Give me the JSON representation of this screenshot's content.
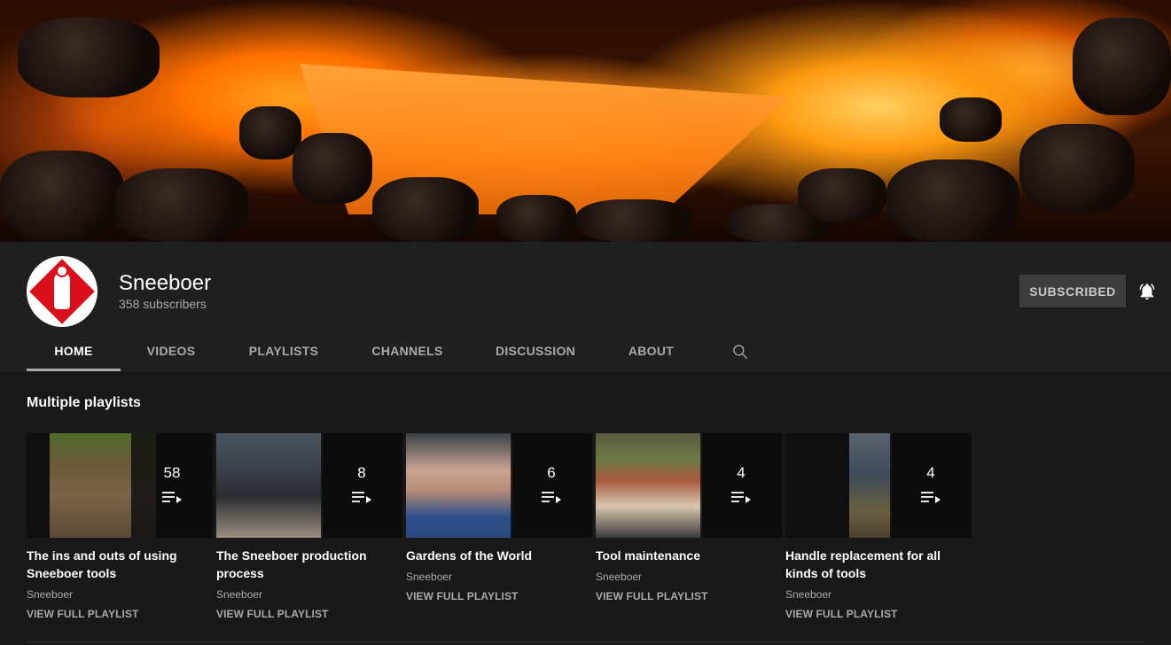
{
  "channel": {
    "name": "Sneeboer",
    "subscribers": "358 subscribers",
    "subscribe_label": "SUBSCRIBED",
    "bell_icon": "bell-icon",
    "brand_color": "#d90f1c"
  },
  "tabs": [
    {
      "label": "HOME",
      "active": true
    },
    {
      "label": "VIDEOS",
      "active": false
    },
    {
      "label": "PLAYLISTS",
      "active": false
    },
    {
      "label": "CHANNELS",
      "active": false
    },
    {
      "label": "DISCUSSION",
      "active": false
    },
    {
      "label": "ABOUT",
      "active": false
    }
  ],
  "section": {
    "title": "Multiple playlists",
    "playlists": [
      {
        "title": "The ins and outs of using Sneeboer tools",
        "count": "58",
        "channel": "Sneeboer",
        "link": "VIEW FULL PLAYLIST"
      },
      {
        "title": "The Sneeboer production process",
        "count": "8",
        "channel": "Sneeboer",
        "link": "VIEW FULL PLAYLIST"
      },
      {
        "title": "Gardens of the World",
        "count": "6",
        "channel": "Sneeboer",
        "link": "VIEW FULL PLAYLIST"
      },
      {
        "title": "Tool maintenance",
        "count": "4",
        "channel": "Sneeboer",
        "link": "VIEW FULL PLAYLIST"
      },
      {
        "title": "Handle replacement for all kinds of tools",
        "count": "4",
        "channel": "Sneeboer",
        "link": "VIEW FULL PLAYLIST"
      }
    ]
  },
  "colors": {
    "background": "#181818",
    "header": "#1f1f1f",
    "subscribed_button": "#3d3d3d"
  }
}
